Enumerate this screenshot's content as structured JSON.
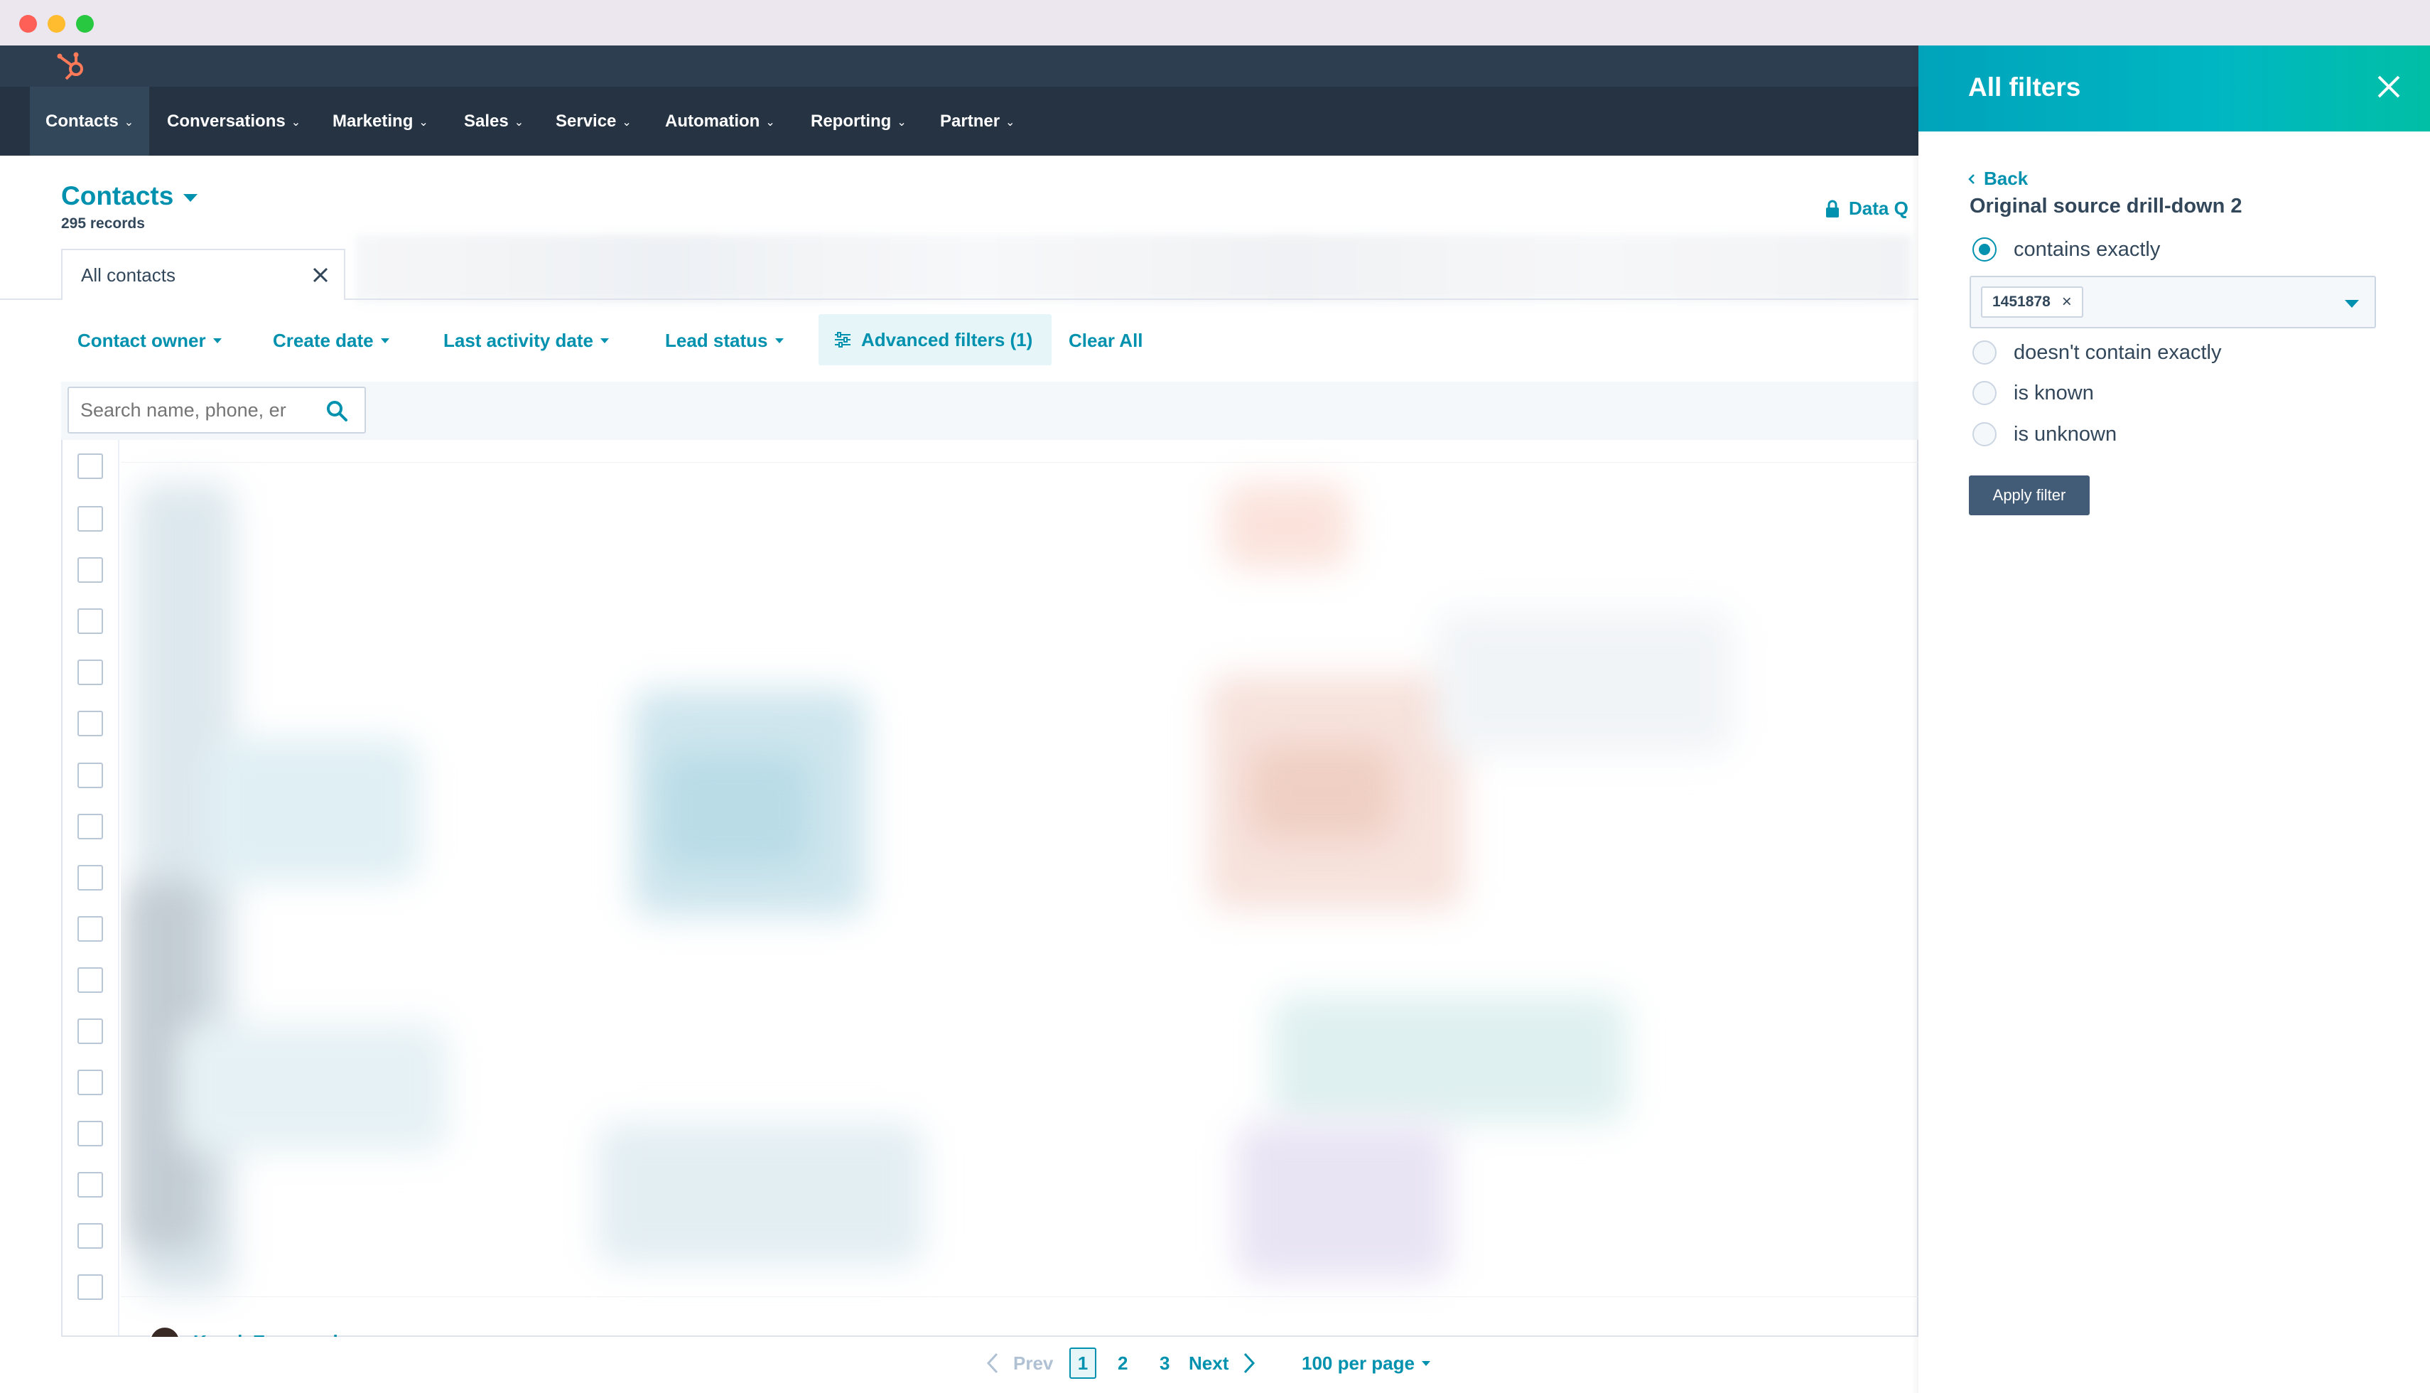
{
  "window": {
    "controls": [
      "close",
      "minimize",
      "maximize"
    ]
  },
  "nav": {
    "logo": "hubspot-logo-icon",
    "items": [
      {
        "label": "Contacts"
      },
      {
        "label": "Conversations"
      },
      {
        "label": "Marketing"
      },
      {
        "label": "Sales"
      },
      {
        "label": "Service"
      },
      {
        "label": "Automation"
      },
      {
        "label": "Reporting"
      },
      {
        "label": "Partner"
      }
    ]
  },
  "page": {
    "title": "Contacts",
    "record_count": "295 records",
    "data_quality_label": "Data Q"
  },
  "views": {
    "active_tab": "All contacts"
  },
  "filters": {
    "quick": [
      {
        "label": "Contact owner"
      },
      {
        "label": "Create date"
      },
      {
        "label": "Last activity date"
      },
      {
        "label": "Lead status"
      }
    ],
    "advanced_label": "Advanced filters (1)",
    "clear_label": "Clear All"
  },
  "table": {
    "search_placeholder": "Search name, phone, er",
    "partial_row_name": "Kavel. Ewaganel"
  },
  "pagination": {
    "prev_label": "Prev",
    "pages": [
      "1",
      "2",
      "3"
    ],
    "current_page": "1",
    "next_label": "Next",
    "per_page_label": "100 per page"
  },
  "panel": {
    "title": "All filters",
    "back_label": "Back",
    "filter_property": "Original source drill-down 2",
    "operators": [
      {
        "label": "contains exactly",
        "selected": true
      },
      {
        "label": "doesn't contain exactly",
        "selected": false
      },
      {
        "label": "is known",
        "selected": false
      },
      {
        "label": "is unknown",
        "selected": false
      }
    ],
    "selected_value": "1451878",
    "apply_label": "Apply filter"
  },
  "colors": {
    "accent": "#0091ae",
    "nav_bg": "#253342",
    "panel_header_start": "#00a3bb",
    "panel_header_end": "#00bfa5",
    "apply_button": "#425b76"
  }
}
